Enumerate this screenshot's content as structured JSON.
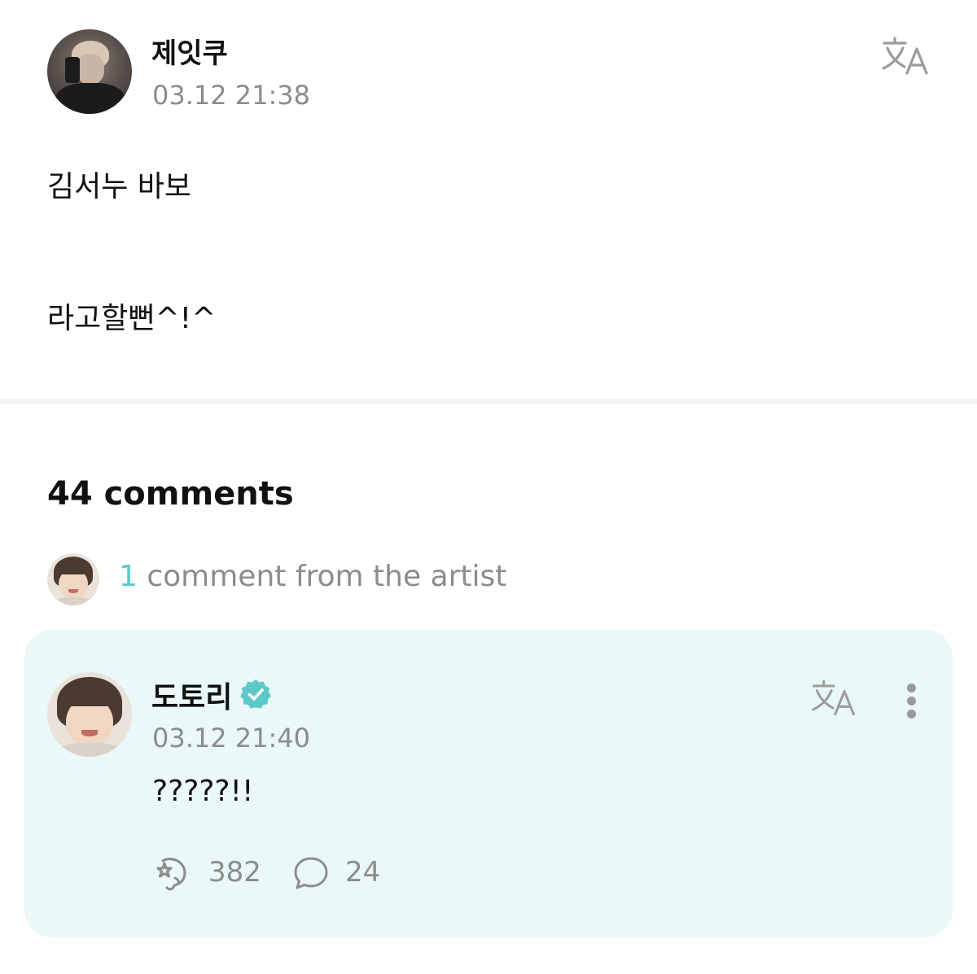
{
  "post": {
    "author": "제잇쿠",
    "timestamp": "03.12 21:38",
    "body_lines": [
      "김서누 바보",
      "라고할뻔^!^"
    ],
    "translate_icon": "translate-icon",
    "avatar_icon": "profile-photo"
  },
  "comments": {
    "count_label": "44 comments",
    "artist_summary": {
      "count": "1",
      "text": " comment from the artist"
    },
    "artist_comment": {
      "author": "도토리",
      "verified_icon": "verified-badge-icon",
      "timestamp": "03.12 21:40",
      "text": "?????!!",
      "likes": "382",
      "replies": "24",
      "translate_icon": "translate-icon",
      "more_icon": "more-vertical-icon"
    }
  },
  "colors": {
    "accent": "#5cc9c9",
    "card_background": "#eaf8f7",
    "muted_text": "#8c8c8c"
  }
}
